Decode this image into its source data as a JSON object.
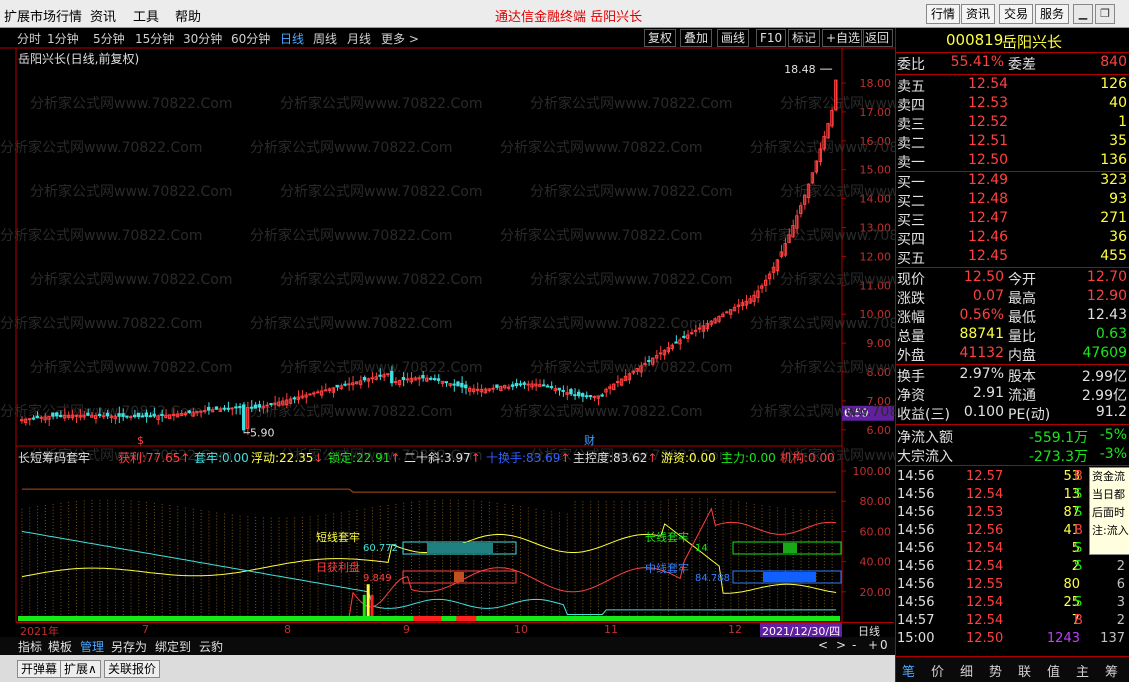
{
  "menu": {
    "items": [
      "扩展市场行情",
      "资讯",
      "工具",
      "帮助"
    ],
    "app_title": "通达信金融终端   岳阳兴长",
    "tabs": [
      "行情",
      "资讯",
      "交易",
      "服务"
    ]
  },
  "toolbar": {
    "periods": [
      "分时",
      "1分钟",
      "5分钟",
      "15分钟",
      "30分钟",
      "60分钟",
      "日线",
      "周线",
      "月线",
      "更多 >"
    ],
    "right_buttons": [
      "复权",
      "叠加",
      "画线",
      "F10",
      "标记",
      "+自选",
      "返回"
    ]
  },
  "main": {
    "title": "岳阳兴长(日线,前复权)",
    "watermark": "分析家公式网www.70822.Com",
    "high_label": "18.48",
    "low_label": "5.90",
    "current_price_tag": "6.59",
    "markers": [
      "$",
      "财"
    ]
  },
  "indicator": {
    "title": "长短筹码套牢",
    "stats": [
      {
        "label": "获利:",
        "value": "77.65",
        "arrow": "↑",
        "color": "#ff4040"
      },
      {
        "label": "套牢:",
        "value": "0.00",
        "arrow": "",
        "color": "#40e0e0"
      },
      {
        "label": "浮动:",
        "value": "22.35",
        "arrow": "↓",
        "color": "#ffff40"
      },
      {
        "label": "锁定:",
        "value": "22.91",
        "arrow": "↑",
        "color": "#18e818"
      },
      {
        "label": "二十斜:",
        "value": "3.97",
        "arrow": "↑",
        "color": "#e0e0e0"
      },
      {
        "label": "十换手:",
        "value": "83.69",
        "arrow": "↑",
        "color": "#3060ff"
      },
      {
        "label": "主控度:",
        "value": "83.62",
        "arrow": "↑",
        "color": "#e0e0e0"
      },
      {
        "label": "游资:",
        "value": "0.00",
        "arrow": "",
        "color": "#ffff40"
      },
      {
        "label": "主力:",
        "value": "0.00",
        "arrow": "",
        "color": "#18e818"
      },
      {
        "label": "机构:",
        "value": "0.00",
        "arrow": "",
        "color": "#ff4040"
      }
    ],
    "annotations": [
      "短线套牢",
      "60.772",
      "日获利盘",
      "9.849",
      "长线套牢",
      "14",
      "中线套牢",
      "84.788"
    ]
  },
  "y_axis_main": [
    "18.00",
    "17.00",
    "16.00",
    "15.00",
    "14.00",
    "13.00",
    "12.00",
    "11.00",
    "10.00",
    "9.00",
    "8.00",
    "7.00",
    "6.00"
  ],
  "y_axis_ind": [
    "100.00",
    "80.00",
    "60.00",
    "40.00",
    "20.00"
  ],
  "x_axis": {
    "labels": [
      "2021年",
      "7",
      "8",
      "9",
      "10",
      "11",
      "12"
    ],
    "date_box": "2021/12/30/四",
    "period": "日线"
  },
  "bottom_tabs": [
    "指标",
    "模板",
    "管理",
    "另存为",
    "绑定到",
    "云豹"
  ],
  "bottom_tab_controls": [
    "<",
    ">",
    "-",
    "+",
    "0"
  ],
  "bottom_bar": [
    "开弹幕",
    "扩展∧",
    "关联报价"
  ],
  "quote": {
    "code": "000819",
    "name": "岳阳兴长",
    "weibi": {
      "label": "委比",
      "value": "55.41%",
      "label2": "委差",
      "value2": "840"
    },
    "asks": [
      {
        "label": "卖五",
        "price": "12.54",
        "vol": "126"
      },
      {
        "label": "卖四",
        "price": "12.53",
        "vol": "40"
      },
      {
        "label": "卖三",
        "price": "12.52",
        "vol": "1"
      },
      {
        "label": "卖二",
        "price": "12.51",
        "vol": "35"
      },
      {
        "label": "卖一",
        "price": "12.50",
        "vol": "136"
      }
    ],
    "bids": [
      {
        "label": "买一",
        "price": "12.49",
        "vol": "323"
      },
      {
        "label": "买二",
        "price": "12.48",
        "vol": "93"
      },
      {
        "label": "买三",
        "price": "12.47",
        "vol": "271"
      },
      {
        "label": "买四",
        "price": "12.46",
        "vol": "36"
      },
      {
        "label": "买五",
        "price": "12.45",
        "vol": "455"
      }
    ],
    "stats": [
      {
        "l1": "现价",
        "v1": "12.50",
        "c1": "#ff4040",
        "l2": "今开",
        "v2": "12.70",
        "c2": "#ff4040"
      },
      {
        "l1": "涨跌",
        "v1": "0.07",
        "c1": "#ff4040",
        "l2": "最高",
        "v2": "12.90",
        "c2": "#ff4040"
      },
      {
        "l1": "涨幅",
        "v1": "0.56%",
        "c1": "#ff4040",
        "l2": "最低",
        "v2": "12.43",
        "c2": "#e0e0e0"
      },
      {
        "l1": "总量",
        "v1": "88741",
        "c1": "#ffff40",
        "l2": "量比",
        "v2": "0.63",
        "c2": "#18e818"
      },
      {
        "l1": "外盘",
        "v1": "41132",
        "c1": "#ff4040",
        "l2": "内盘",
        "v2": "47609",
        "c2": "#18e818"
      }
    ],
    "stats2": [
      {
        "l1": "换手",
        "v1": "2.97%",
        "l2": "股本",
        "v2": "2.99亿"
      },
      {
        "l1": "净资",
        "v1": "2.91",
        "l2": "流通",
        "v2": "2.99亿"
      },
      {
        "l1": "收益(三)",
        "v1": "0.100",
        "l2": "PE(动)",
        "v2": "91.2"
      }
    ],
    "flow": [
      {
        "label": "净流入额",
        "value": "-559.1万",
        "pct": "-5%"
      },
      {
        "label": "大宗流入",
        "value": "-273.3万",
        "pct": "-3%"
      }
    ],
    "tooltip": [
      "资金流",
      "当日都",
      "后面时",
      "注:流入"
    ],
    "ticks": [
      {
        "t": "14:56",
        "p": "12.57",
        "v": "53",
        "f": "B",
        "n": ""
      },
      {
        "t": "14:56",
        "p": "12.54",
        "v": "13",
        "f": "S",
        "n": ""
      },
      {
        "t": "14:56",
        "p": "12.53",
        "v": "87",
        "f": "S",
        "n": ""
      },
      {
        "t": "14:56",
        "p": "12.56",
        "v": "41",
        "f": "B",
        "n": ""
      },
      {
        "t": "14:56",
        "p": "12.54",
        "v": "5",
        "f": "S",
        "n": ""
      },
      {
        "t": "14:56",
        "p": "12.54",
        "v": "2",
        "f": "S",
        "n": "2"
      },
      {
        "t": "14:56",
        "p": "12.55",
        "v": "80",
        "f": "",
        "n": "6"
      },
      {
        "t": "14:56",
        "p": "12.54",
        "v": "25",
        "f": "S",
        "n": "3"
      },
      {
        "t": "14:57",
        "p": "12.54",
        "v": "7",
        "f": "B",
        "n": "2"
      },
      {
        "t": "15:00",
        "p": "12.50",
        "v": "1243",
        "f": "",
        "n": "137"
      }
    ],
    "tabs": [
      "笔",
      "价",
      "细",
      "势",
      "联",
      "值",
      "主",
      "筹"
    ]
  },
  "colors": {
    "up": "#ff4040",
    "down": "#18e818",
    "candle_down": "#40e0e0",
    "axis": "#b00000"
  }
}
